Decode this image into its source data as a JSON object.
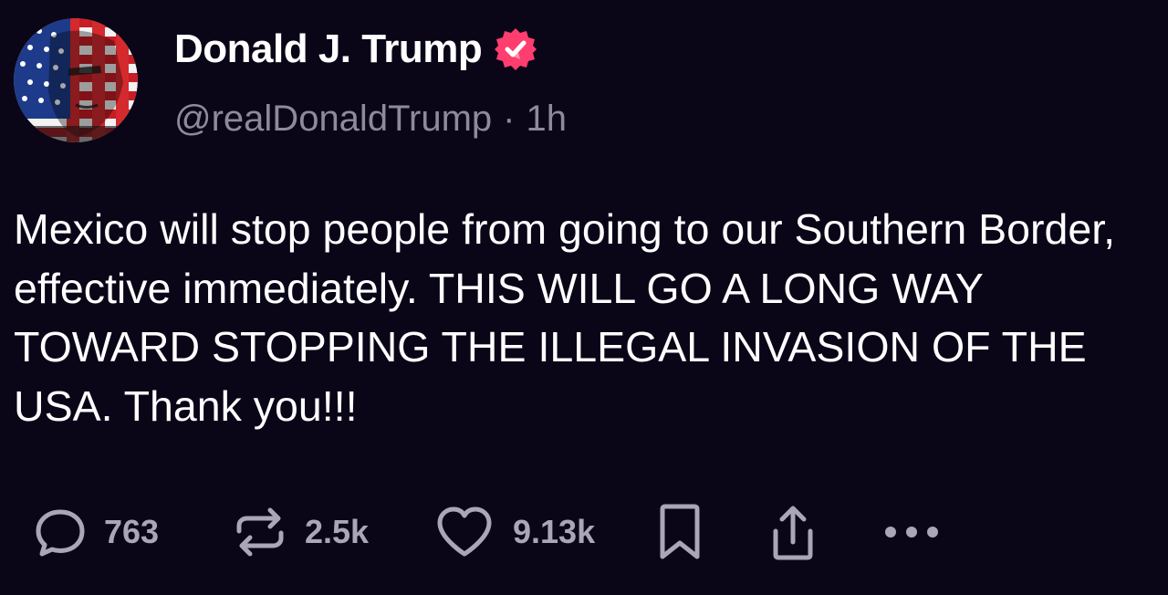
{
  "author": {
    "display_name": "Donald J. Trump",
    "handle": "@realDonaldTrump",
    "separator": "·",
    "time_ago": "1h",
    "verified_color": "#ff3d6e"
  },
  "post": {
    "text": "Mexico will stop people from going to our Southern Border, effective immediately. THIS WILL GO A LONG WAY TOWARD STOPPING THE ILLEGAL INVASION OF THE USA. Thank you!!!"
  },
  "actions": {
    "reply": {
      "icon": "reply-bubble-icon",
      "count": "763"
    },
    "repost": {
      "icon": "repost-icon",
      "count": "2.5k"
    },
    "like": {
      "icon": "heart-icon",
      "count": "9.13k"
    },
    "bookmark": {
      "icon": "bookmark-icon"
    },
    "share": {
      "icon": "share-icon"
    },
    "more": {
      "icon": "more-dots-icon"
    }
  },
  "colors": {
    "background": "#0a0618",
    "text_primary": "#ffffff",
    "text_secondary": "#8e8a9c",
    "action_gray": "#aaa6b6"
  }
}
